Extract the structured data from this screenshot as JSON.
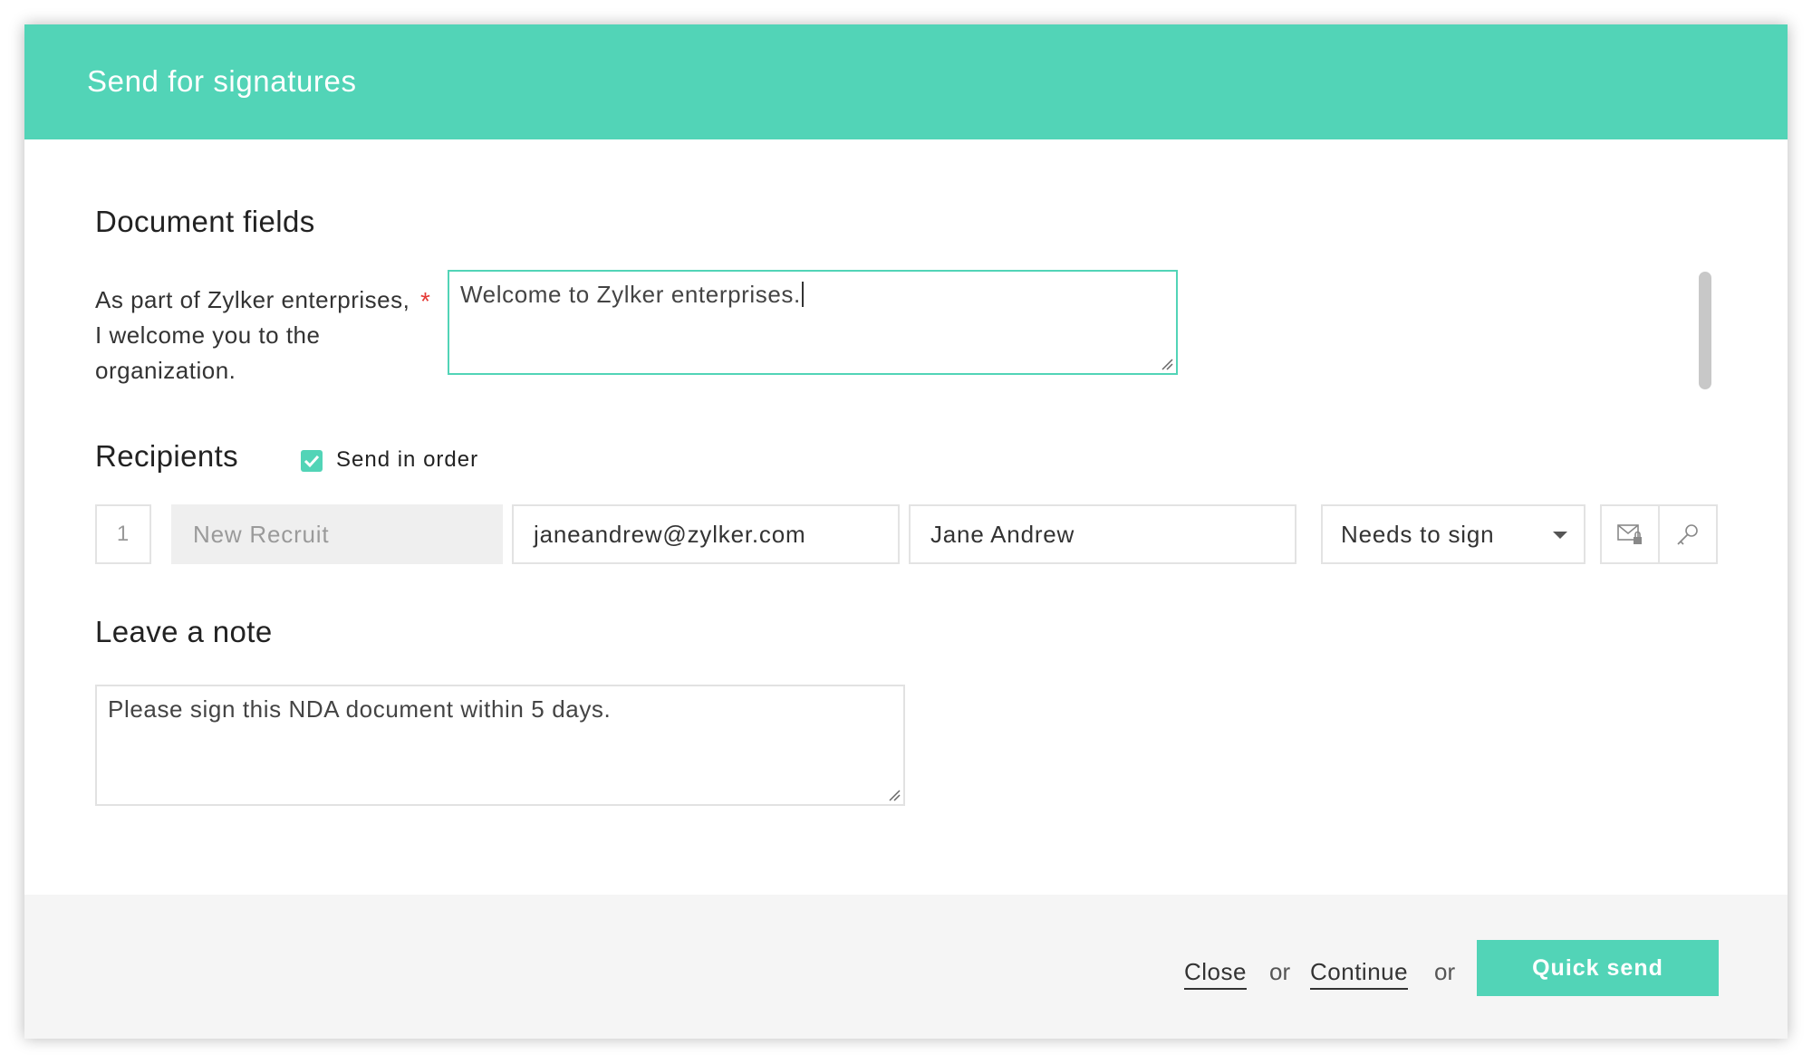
{
  "header": {
    "title": "Send for signatures"
  },
  "document_fields": {
    "title": "Document fields",
    "field_label": "As part of Zylker enterprises, I welcome you to the organization.",
    "required_mark": "*",
    "field_value": "Welcome to Zylker enterprises."
  },
  "recipients": {
    "title": "Recipients",
    "send_in_order_label": "Send in order",
    "send_in_order_checked": true,
    "rows": [
      {
        "order": "1",
        "role_placeholder": "New Recruit",
        "email": "janeandrew@zylker.com",
        "name": "Jane Andrew",
        "action": "Needs to sign"
      }
    ]
  },
  "note": {
    "title": "Leave a note",
    "value": "Please sign this NDA document within 5 days."
  },
  "footer": {
    "close_label": "Close",
    "or_label_1": "or",
    "continue_label": "Continue",
    "or_label_2": "or",
    "quick_send_label": "Quick send"
  },
  "colors": {
    "accent": "#52d4b7",
    "required": "#e53935",
    "footer_bg": "#f5f5f5"
  },
  "icons": {
    "private_message": "envelope-lock-icon",
    "access_key": "key-icon",
    "dropdown": "chevron-down-icon",
    "checkbox": "checkmark-icon"
  }
}
